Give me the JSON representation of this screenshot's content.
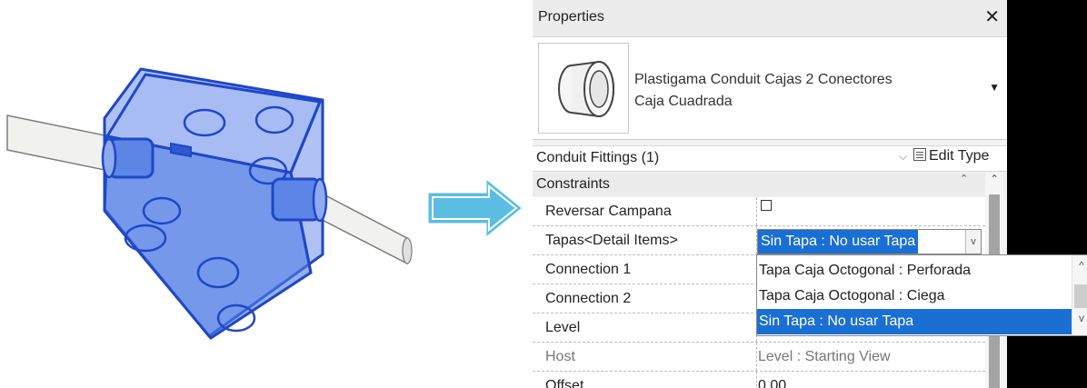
{
  "panel": {
    "title": "Properties",
    "close_glyph": "✕",
    "type_name_line1": "Plastigama Conduit Cajas 2 Conectores",
    "type_name_line2": "Caja Cuadrada",
    "type_dropdown_glyph": "▼",
    "filter_label": "Conduit Fittings (1)",
    "filter_chevron": "⌵",
    "edit_type_label": "Edit Type",
    "section_label": "Constraints",
    "section_collapse_glyph": "⌃"
  },
  "properties": [
    {
      "name": "Reversar Campana",
      "value": ""
    },
    {
      "name": "Tapas<Detail Items>",
      "value": "Sin Tapa : No usar Tapa"
    },
    {
      "name": "Connection 1",
      "value": ""
    },
    {
      "name": "Connection 2",
      "value": ""
    },
    {
      "name": "Level",
      "value": ""
    },
    {
      "name": "Host",
      "value": "Level : Starting View"
    },
    {
      "name": "Offset",
      "value": "0.00"
    }
  ],
  "dropdown": {
    "options": [
      "Tapa Caja Octogonal : Perforada",
      "Tapa Caja Octogonal : Ciega",
      "Sin Tapa : No usar Tapa"
    ],
    "selected_index": 2,
    "up_glyph": "^",
    "down_glyph": "v"
  },
  "colors": {
    "selection": "#1a6fd3",
    "box_fill": "#3f6fe0",
    "box_stroke": "#1f47c8",
    "arrow": "#5bbde2"
  },
  "icons": {
    "illustration": "conduit-box-icon",
    "arrow": "right-arrow-icon",
    "thumbnail": "conduit-fitting-icon",
    "edit_type": "edit-type-icon",
    "checkbox": "checkbox-icon"
  }
}
